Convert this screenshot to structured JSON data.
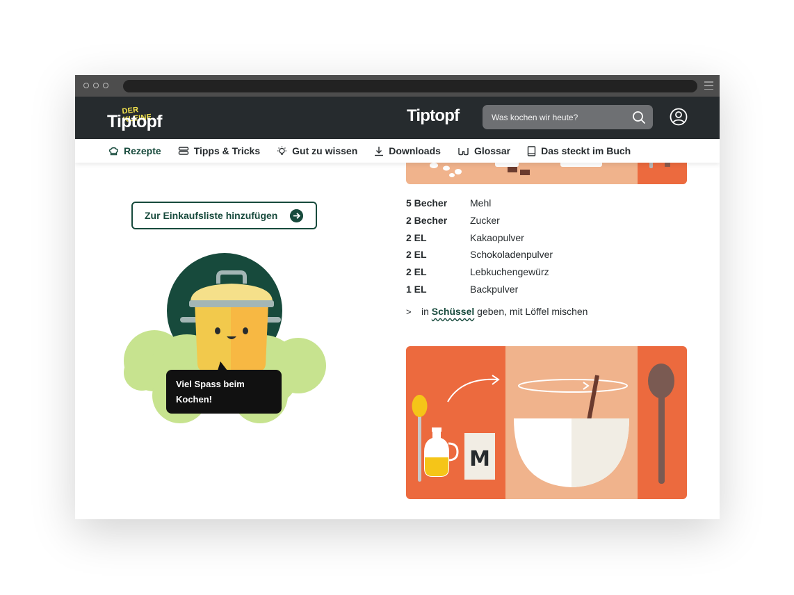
{
  "header": {
    "logo_small": "DER KLEINE",
    "logo_main": "Tiptopf",
    "logo_center": "Tiptopf",
    "search_placeholder": "Was kochen wir heute?"
  },
  "nav": {
    "items": [
      {
        "label": "Rezepte",
        "icon": "chef-hat-icon"
      },
      {
        "label": "Tipps & Tricks",
        "icon": "tips-stack-icon"
      },
      {
        "label": "Gut zu wissen",
        "icon": "lightbulb-icon"
      },
      {
        "label": "Downloads",
        "icon": "download-icon"
      },
      {
        "label": "Glossar",
        "icon": "glasses-icon"
      },
      {
        "label": "Das steckt im Buch",
        "icon": "book-icon"
      }
    ]
  },
  "cart_button": {
    "label": "Zur Einkaufsliste hinzufügen",
    "icon": "arrow-right-circle-icon"
  },
  "mascot": {
    "speech": "Viel Spass beim Kochen!"
  },
  "ingredients": [
    {
      "qty": "5 Becher",
      "name": "Mehl"
    },
    {
      "qty": "2 Becher",
      "name": "Zucker"
    },
    {
      "qty": "2 EL",
      "name": "Kakaopulver"
    },
    {
      "qty": "2 EL",
      "name": "Schokoladenpulver"
    },
    {
      "qty": "2 EL",
      "name": "Lebkuchengewürz"
    },
    {
      "qty": "1 EL",
      "name": "Backpulver"
    }
  ],
  "step": {
    "marker": ">",
    "prefix": "in",
    "link": "Schüssel",
    "suffix": "geben, mit Löffel mischen"
  },
  "illustration": {
    "jar_letter": "M"
  },
  "colors": {
    "header_bg": "#262b2e",
    "brand_green": "#174a3c",
    "orange": "#ec6a3e",
    "peach": "#f0b38c",
    "mascot_cloud": "#c7e38f",
    "logo_yellow": "#f2e24d"
  }
}
